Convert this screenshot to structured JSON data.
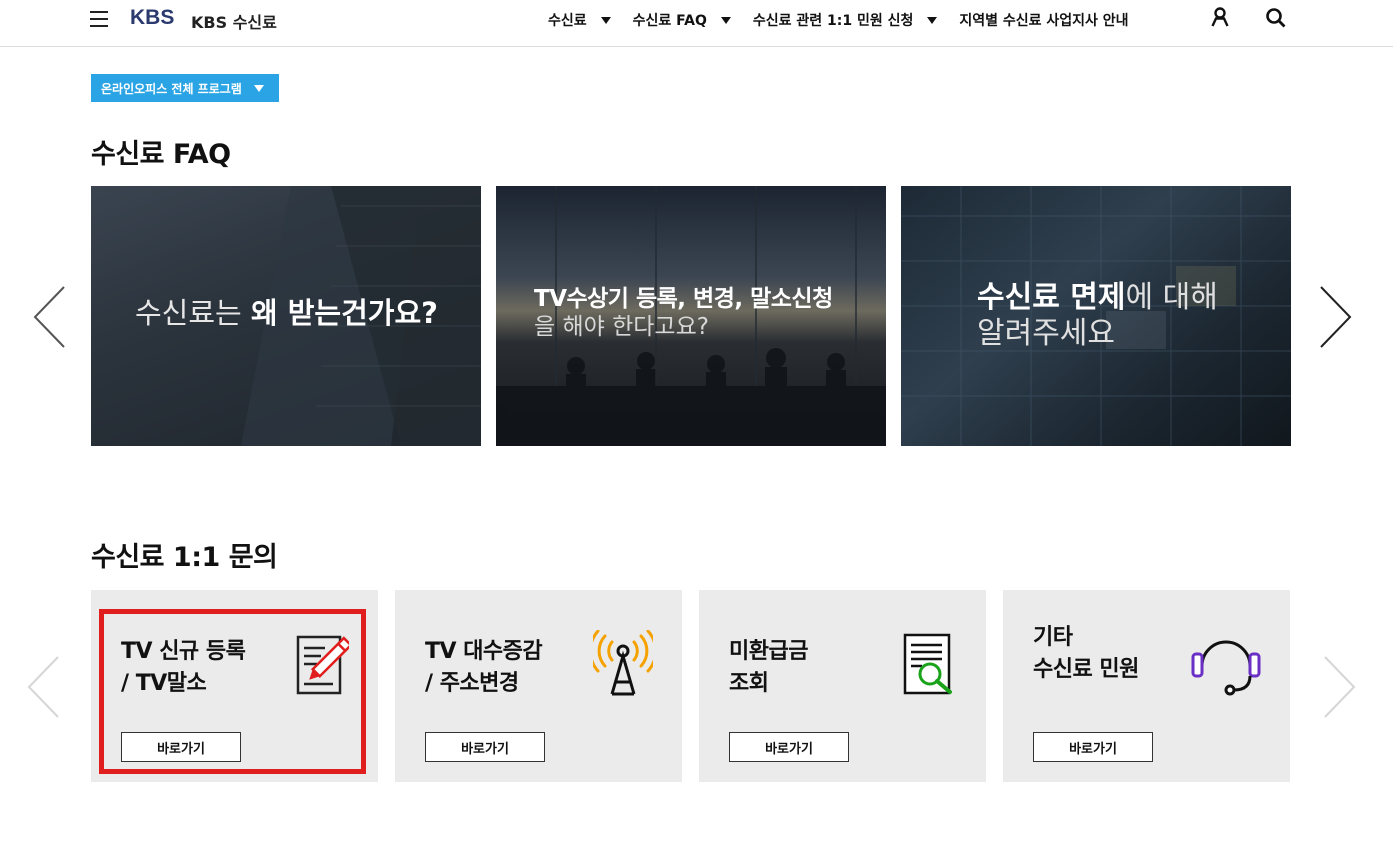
{
  "header": {
    "logo": "KBS",
    "site_title": "KBS 수신료",
    "nav": [
      {
        "label": "수신료",
        "has_dropdown": true
      },
      {
        "label": "수신료 FAQ",
        "has_dropdown": true
      },
      {
        "label": "수신료 관련 1:1 민원 신청",
        "has_dropdown": true
      },
      {
        "label": "지역별 수신료 사업지사 안내",
        "has_dropdown": false
      }
    ],
    "icons": [
      "menu-icon",
      "user-icon",
      "search-icon"
    ]
  },
  "program_dropdown": {
    "label": "온라인오피스 전체 프로그램"
  },
  "faq_section": {
    "title": "수신료 FAQ",
    "cards": [
      {
        "light": "수신료는 ",
        "bold": "왜 받는건가요?"
      },
      {
        "bold": "TV수상기 등록, 변경, 말소신청",
        "light": "을 해야 한다고요?"
      },
      {
        "bold": "수신료 면제",
        "light_inline": "에 대해",
        "light": "알려주세요"
      }
    ]
  },
  "inquiry_section": {
    "title": "수신료 1:1 문의",
    "cards": [
      {
        "label": "TV 신규 등록\n/ TV말소",
        "button": "바로가기",
        "icon": "pencil-document-icon"
      },
      {
        "label": "TV 대수증감\n/ 주소변경",
        "button": "바로가기",
        "icon": "antenna-icon"
      },
      {
        "label": "미환급금\n조회",
        "button": "바로가기",
        "icon": "document-search-icon"
      },
      {
        "label": "기타\n수신료 민원",
        "button": "바로가기",
        "icon": "headset-icon"
      }
    ]
  },
  "colors": {
    "accent": "#2aa4e4",
    "logo": "#2b3a6e",
    "highlight": "#e01e1e"
  }
}
